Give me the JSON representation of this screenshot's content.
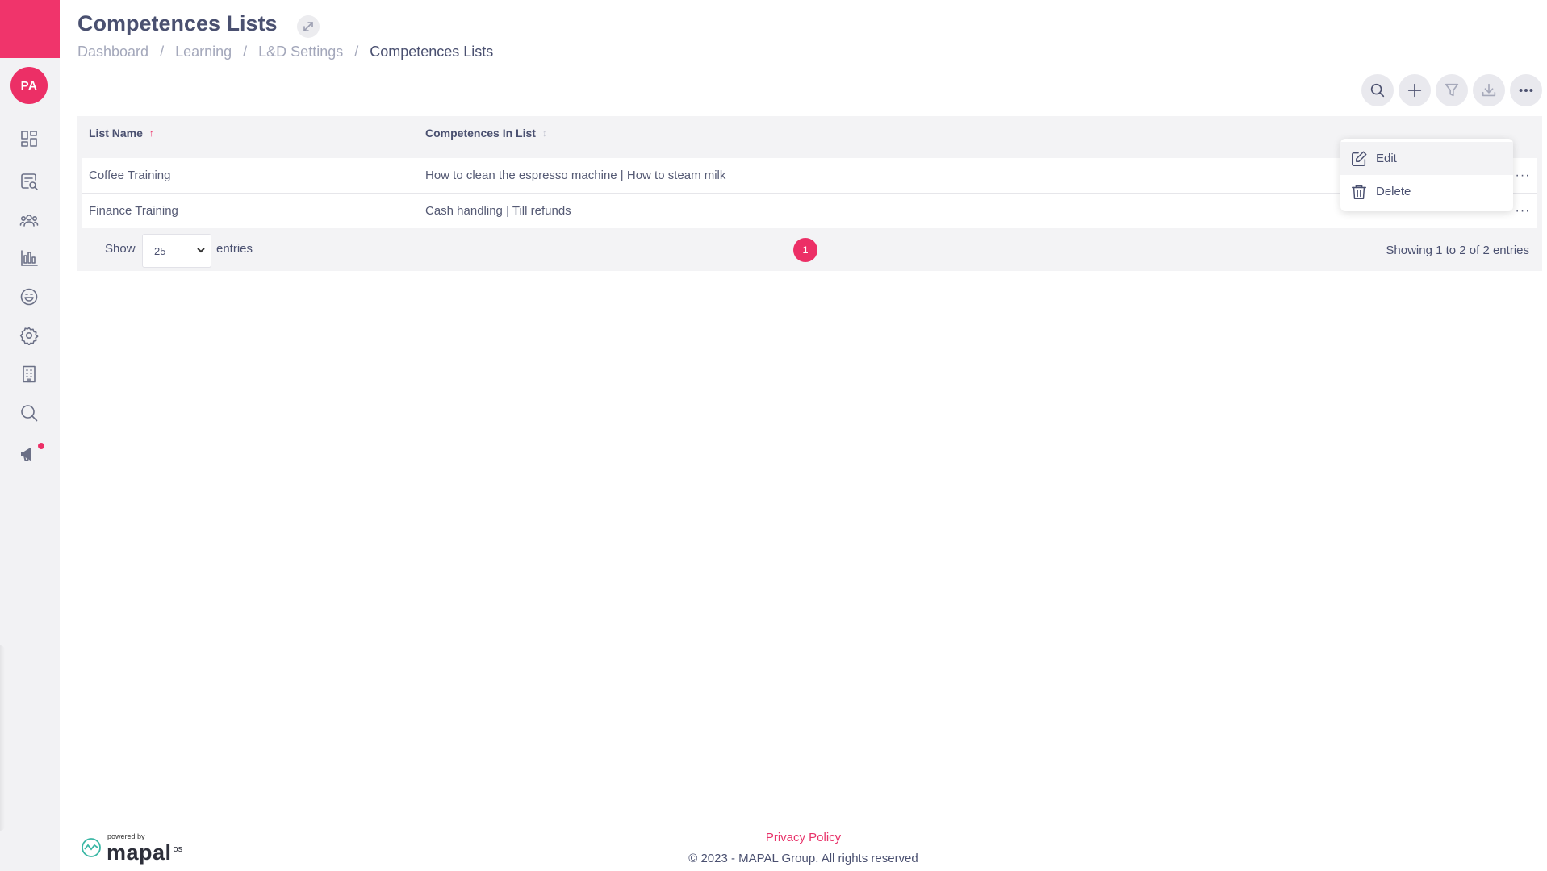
{
  "sidebar": {
    "avatar_initials": "PA",
    "items": [
      {
        "icon": "dashboard-icon"
      },
      {
        "icon": "search-document-icon"
      },
      {
        "icon": "people-icon"
      },
      {
        "icon": "bar-chart-icon"
      },
      {
        "icon": "smiley-icon"
      },
      {
        "icon": "gear-icon"
      },
      {
        "icon": "building-icon"
      },
      {
        "icon": "search-icon"
      },
      {
        "icon": "megaphone-icon"
      }
    ]
  },
  "header": {
    "title": "Competences Lists",
    "breadcrumb": [
      "Dashboard",
      "Learning",
      "L&D Settings",
      "Competences Lists"
    ],
    "breadcrumb_separator": "/"
  },
  "toolbar": {
    "buttons": [
      "search-icon",
      "plus-icon",
      "filter-icon",
      "download-icon",
      "more-icon"
    ]
  },
  "table": {
    "columns": [
      {
        "label": "List Name",
        "sort": "↑"
      },
      {
        "label": "Competences In List",
        "sort": "↕"
      }
    ],
    "rows": [
      {
        "name": "Coffee Training",
        "competences": "How to clean the espresso machine | How to steam milk"
      },
      {
        "name": "Finance Training",
        "competences": "Cash handling | Till refunds"
      }
    ],
    "row_action": "···",
    "show_label": "Show",
    "page_size": "25",
    "entries_label": "entries",
    "current_page": "1",
    "summary": "Showing 1 to 2 of 2 entries"
  },
  "dropdown": {
    "items": [
      {
        "label": "Edit",
        "icon": "edit-icon"
      },
      {
        "label": "Delete",
        "icon": "trash-icon"
      }
    ]
  },
  "footer": {
    "powered_by": "powered by",
    "logo_text": "mapal",
    "logo_suffix": "os",
    "privacy": "Privacy Policy",
    "copyright": "© 2023 - MAPAL Group. All rights reserved"
  },
  "colors": {
    "accent": "#ec2f66",
    "sidebar_bg": "#f2f2f4",
    "text": "#4a5070"
  }
}
